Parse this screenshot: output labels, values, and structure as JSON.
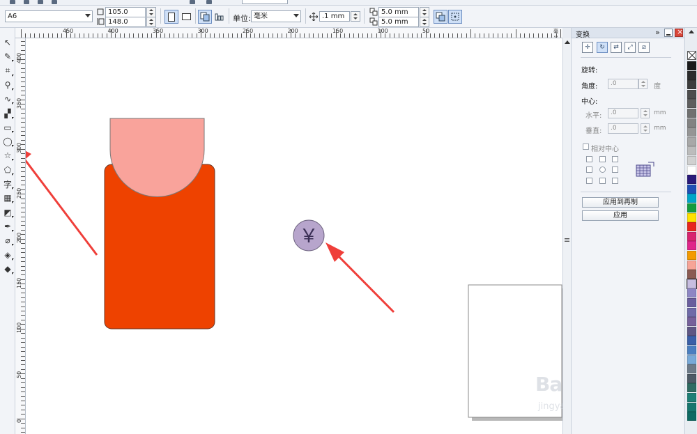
{
  "propbar": {
    "paper_size": "A6",
    "width_value": "105.0 mm",
    "height_value": "148.0 mm",
    "units_label": "单位:",
    "units_value": "毫米",
    "nudge_value": ".1 mm",
    "dup_x_value": "5.0 mm",
    "dup_y_value": "5.0 mm"
  },
  "toolbox": {
    "tools": [
      {
        "name": "pick-tool-icon",
        "glyph": "↖"
      },
      {
        "name": "shape-tool-icon",
        "glyph": "✎"
      },
      {
        "name": "crop-tool-icon",
        "glyph": "⌗"
      },
      {
        "name": "zoom-tool-icon",
        "glyph": "⚲"
      },
      {
        "name": "freehand-tool-icon",
        "glyph": "∿"
      },
      {
        "name": "smart-fill-tool-icon",
        "glyph": "▞"
      },
      {
        "name": "rectangle-tool-icon",
        "glyph": "▭"
      },
      {
        "name": "ellipse-tool-icon",
        "glyph": "◯"
      },
      {
        "name": "polygon-tool-icon",
        "glyph": "☆"
      },
      {
        "name": "basic-shapes-tool-icon",
        "glyph": "⬠"
      },
      {
        "name": "text-tool-icon",
        "glyph": "字"
      },
      {
        "name": "table-tool-icon",
        "glyph": "▦"
      },
      {
        "name": "interactive-tool-icon",
        "glyph": "◩"
      },
      {
        "name": "eyedropper-tool-icon",
        "glyph": "✒"
      },
      {
        "name": "outline-pen-tool-icon",
        "glyph": "⌀"
      },
      {
        "name": "fill-tool-icon",
        "glyph": "◈"
      },
      {
        "name": "interactive-fill-tool-icon",
        "glyph": "◆"
      }
    ]
  },
  "ruler": {
    "h_labels": [
      "450",
      "400",
      "350",
      "300",
      "250",
      "200",
      "150",
      "100",
      "50"
    ],
    "v_labels": [
      "400",
      "350",
      "300",
      "250",
      "200",
      "150",
      "100",
      "50",
      "0"
    ],
    "unit": "毫米"
  },
  "canvas": {
    "currency_symbol": "￥",
    "colors": {
      "orange_shape": "#ee4200",
      "pink_shape": "#f9a39b",
      "circle_fill": "#b7a5cc",
      "arrow": "#ef3f3a"
    }
  },
  "docker": {
    "title": "变换",
    "rotate_heading": "旋转:",
    "angle_label": "角度:",
    "angle_value": ".0",
    "angle_unit": "度",
    "center_heading": "中心:",
    "horizontal_label": "水平:",
    "horizontal_value": ".0",
    "vertical_label": "垂直:",
    "vertical_value": ".0",
    "unit_mm": "mm",
    "relative_center_label": "相对中心",
    "apply_to_duplicate_label": "应用到再制",
    "apply_label": "应用"
  },
  "palette": {
    "colors": [
      "#1a1a1a",
      "#2b2b2b",
      "#3c3c3c",
      "#4d4d4d",
      "#5e5e5e",
      "#707070",
      "#828282",
      "#959595",
      "#a8a8a8",
      "#bcbcbc",
      "#d0d0d0",
      "#ffffff",
      "#2a1a7a",
      "#1f4fb5",
      "#00a5c8",
      "#159b3d",
      "#ffe100",
      "#e8261e",
      "#d8246f",
      "#e0268a",
      "#f39a00",
      "#f7a497",
      "#8a5a52",
      "#c7bde0",
      "#8d86c4",
      "#6a5e9e",
      "#6f6aa8",
      "#76609a",
      "#5e5684",
      "#3a5fa8",
      "#4a7ec0",
      "#78a9d8",
      "#6d7a88",
      "#4e5a66",
      "#2f6b62",
      "#1e7f76",
      "#17766e",
      "#0f6a63"
    ]
  },
  "watermark": {
    "brand": "Bai du 经验",
    "url": "jingyan.baidu.com"
  }
}
